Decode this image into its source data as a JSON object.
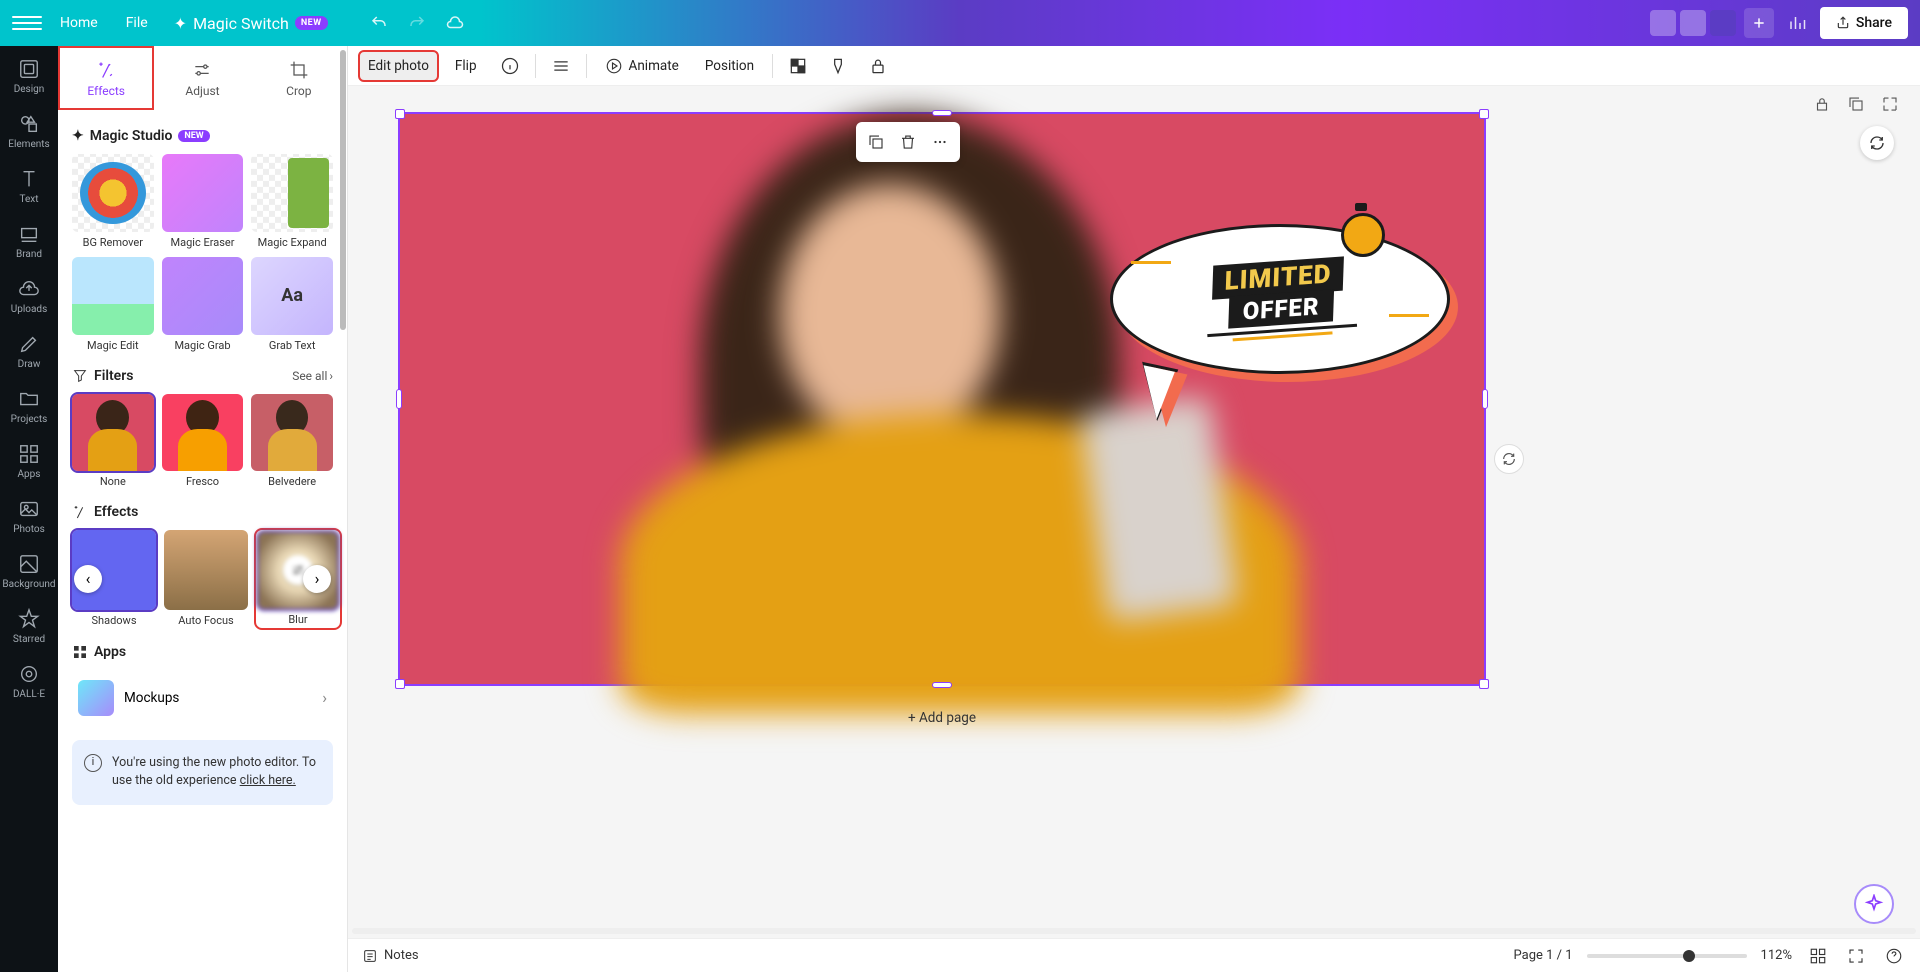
{
  "topbar": {
    "home": "Home",
    "file": "File",
    "magic_switch": "Magic Switch",
    "magic_switch_badge": "NEW",
    "share": "Share"
  },
  "rail": {
    "design": "Design",
    "elements": "Elements",
    "text": "Text",
    "brand": "Brand",
    "uploads": "Uploads",
    "draw": "Draw",
    "projects": "Projects",
    "apps": "Apps",
    "photos": "Photos",
    "background": "Background",
    "starred": "Starred",
    "dalle": "DALL·E"
  },
  "panel_tabs": {
    "effects": "Effects",
    "adjust": "Adjust",
    "crop": "Crop"
  },
  "sections": {
    "magic_studio": "Magic Studio",
    "magic_studio_badge": "NEW",
    "filters": "Filters",
    "see_all": "See all",
    "effects": "Effects",
    "apps": "Apps"
  },
  "magic_studio_tiles": {
    "bg_remover": "BG Remover",
    "magic_eraser": "Magic Eraser",
    "magic_expand": "Magic Expand",
    "magic_edit": "Magic Edit",
    "magic_grab": "Magic Grab",
    "grab_text": "Grab Text"
  },
  "filter_tiles": {
    "none": "None",
    "fresco": "Fresco",
    "belvedere": "Belvedere"
  },
  "effect_tiles": {
    "shadows": "Shadows",
    "auto_focus": "Auto Focus",
    "blur": "Blur"
  },
  "apps": {
    "mockups": "Mockups"
  },
  "info": {
    "line1": "You're using the new photo editor.",
    "line2a": "To use the old experience ",
    "link": "click here.",
    "line2b": ""
  },
  "context_toolbar": {
    "edit_photo": "Edit photo",
    "flip": "Flip",
    "animate": "Animate",
    "position": "Position"
  },
  "canvas": {
    "speech_line1": "LIMITED",
    "speech_line2": "OFFER",
    "add_page": "+ Add page"
  },
  "bottombar": {
    "notes": "Notes",
    "page_label": "Page 1 / 1",
    "zoom": "112%"
  }
}
